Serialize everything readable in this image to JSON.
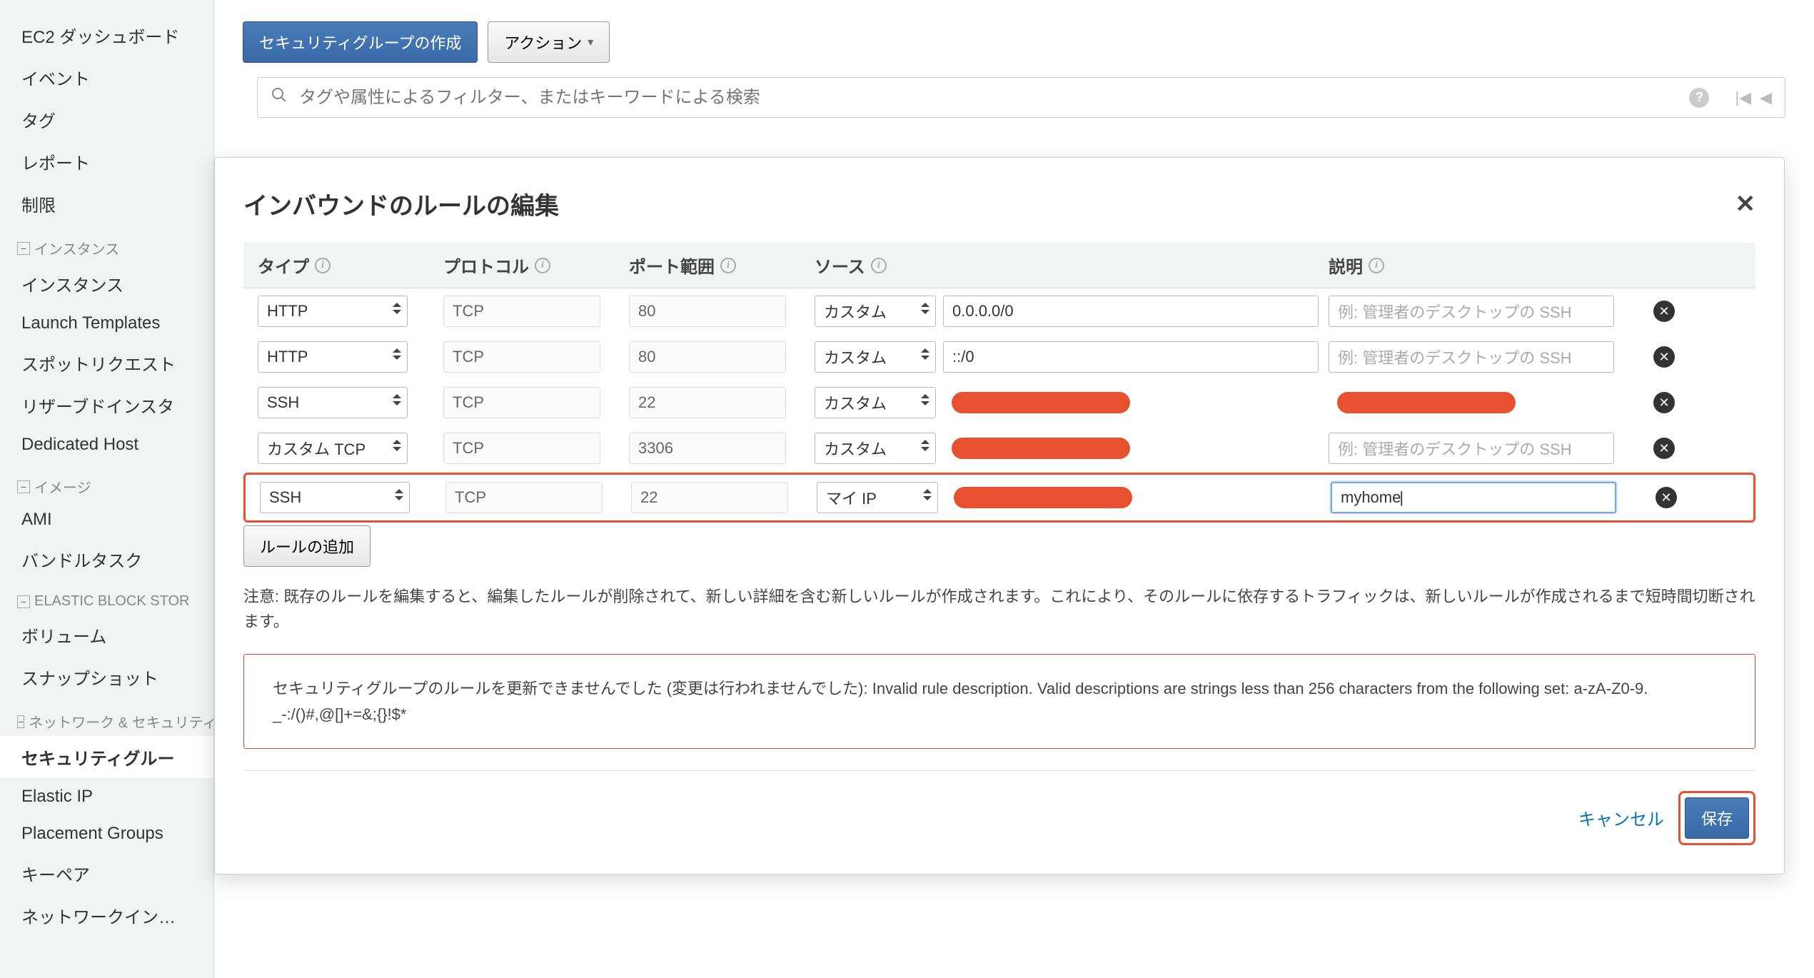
{
  "sidebar": {
    "top": [
      "EC2 ダッシュボード",
      "イベント",
      "タグ",
      "レポート",
      "制限"
    ],
    "sections": [
      {
        "title": "インスタンス",
        "items": [
          "インスタンス",
          "Launch Templates",
          "スポットリクエスト",
          "リザーブドインスタ",
          "Dedicated Host"
        ]
      },
      {
        "title": "イメージ",
        "items": [
          "AMI",
          "バンドルタスク"
        ]
      },
      {
        "title": "ELASTIC BLOCK STOR",
        "items": [
          "ボリューム",
          "スナップショット"
        ]
      },
      {
        "title": "ネットワーク & セキュリティ",
        "items": [
          "セキュリティグルー",
          "Elastic IP",
          "Placement Groups",
          "キーペア",
          "ネットワークインターフェイス"
        ]
      }
    ],
    "active": "セキュリティグルー"
  },
  "toolbar": {
    "create": "セキュリティグループの作成",
    "actions": "アクション"
  },
  "search": {
    "placeholder": "タグや属性によるフィルター、またはキーワードによる検索"
  },
  "modal": {
    "title": "インバウンドのルールの編集",
    "headers": {
      "type": "タイプ",
      "protocol": "プロトコル",
      "port": "ポート範囲",
      "source": "ソース",
      "desc": "説明"
    },
    "desc_placeholder": "例: 管理者のデスクトップの SSH",
    "rules": [
      {
        "type": "HTTP",
        "protocol": "TCP",
        "port": "80",
        "source_mode": "カスタム",
        "source_value": "0.0.0.0/0",
        "desc": "",
        "redacted_source": false,
        "redacted_desc": false,
        "highlight": false
      },
      {
        "type": "HTTP",
        "protocol": "TCP",
        "port": "80",
        "source_mode": "カスタム",
        "source_value": "::/0",
        "desc": "",
        "redacted_source": false,
        "redacted_desc": false,
        "highlight": false
      },
      {
        "type": "SSH",
        "protocol": "TCP",
        "port": "22",
        "source_mode": "カスタム",
        "source_value": "",
        "desc": "",
        "redacted_source": true,
        "redacted_desc": true,
        "highlight": false
      },
      {
        "type": "カスタム TCP",
        "protocol": "TCP",
        "port": "3306",
        "source_mode": "カスタム",
        "source_value": "",
        "desc": "",
        "redacted_source": true,
        "redacted_desc": false,
        "highlight": false
      },
      {
        "type": "SSH",
        "protocol": "TCP",
        "port": "22",
        "source_mode": "マイ IP",
        "source_value": "",
        "desc": "myhome",
        "redacted_source": true,
        "redacted_desc": false,
        "highlight": true,
        "desc_focus": true
      }
    ],
    "add_rule": "ルールの追加",
    "note": "注意: 既存のルールを編集すると、編集したルールが削除されて、新しい詳細を含む新しいルールが作成されます。これにより、そのルールに依存するトラフィックは、新しいルールが作成されるまで短時間切断されます。",
    "error": "セキュリティグループのルールを更新できませんでした (変更は行われませんでした): Invalid rule description. Valid descriptions are strings less than 256 characters from the following set: a-zA-Z0-9. _-:/()#,@[]+=&;{}!$*",
    "cancel": "キャンセル",
    "save": "保存"
  }
}
